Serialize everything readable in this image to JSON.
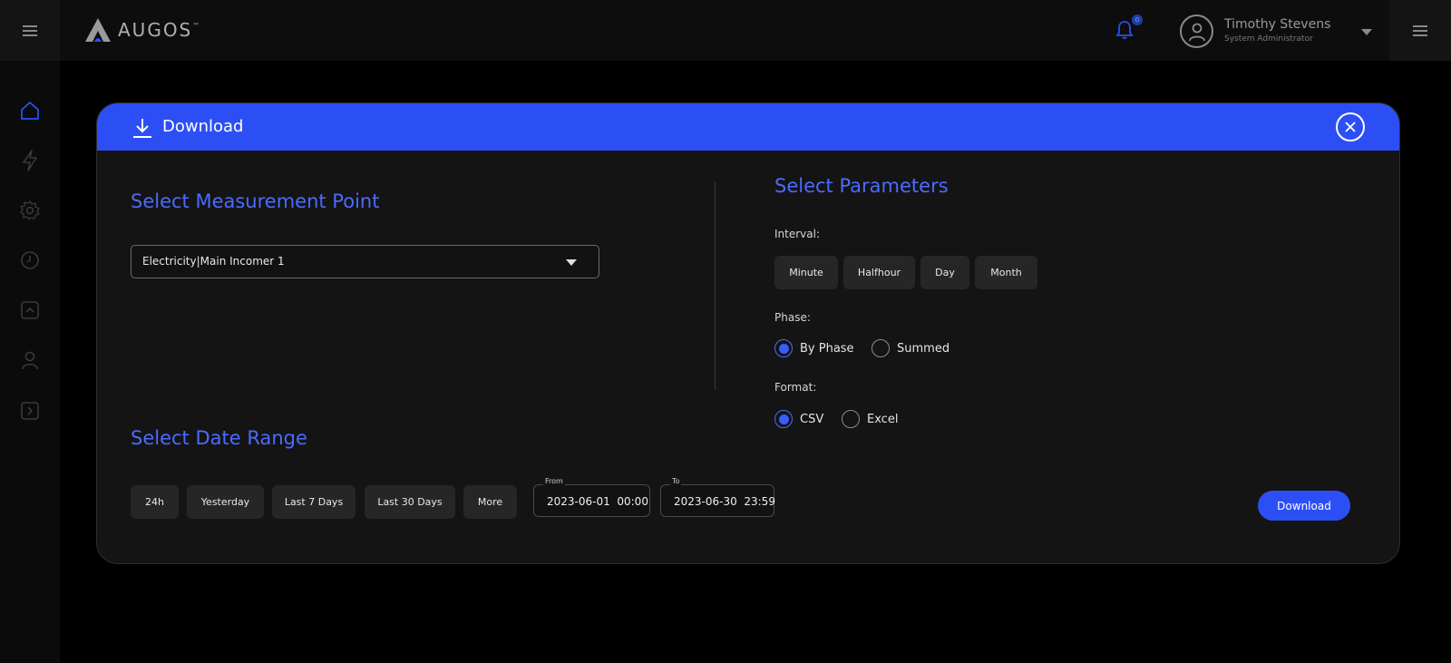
{
  "app": {
    "brand": "AUGOS",
    "brand_tm": "™",
    "notification_count": "0",
    "user": {
      "name": "Timothy Stevens",
      "role": "System Administrator"
    }
  },
  "sidebar": {
    "items": [
      {
        "icon": "home-icon"
      },
      {
        "icon": "lightning-icon"
      },
      {
        "icon": "gear-icon"
      },
      {
        "icon": "clock-icon"
      },
      {
        "icon": "chevron-up-box-icon"
      },
      {
        "icon": "user-icon"
      },
      {
        "icon": "chevron-right-box-icon"
      }
    ]
  },
  "modal": {
    "title": "Download",
    "measurement": {
      "title": "Select Measurement Point",
      "selected": "Electricity|Main Incomer 1"
    },
    "parameters": {
      "title": "Select Parameters",
      "interval_label": "Interval:",
      "intervals": [
        "Minute",
        "Halfhour",
        "Day",
        "Month"
      ],
      "phase_label": "Phase:",
      "phase_options": [
        "By Phase",
        "Summed"
      ],
      "phase_selected": "By Phase",
      "format_label": "Format:",
      "format_options": [
        "CSV",
        "Excel"
      ],
      "format_selected": "CSV"
    },
    "date_range": {
      "title": "Select Date Range",
      "presets": [
        "24h",
        "Yesterday",
        "Last 7 Days",
        "Last 30 Days",
        "More"
      ],
      "from_label": "From",
      "from_value": "2023-06-01  00:00",
      "to_label": "To",
      "to_value": "2023-06-30  23:59"
    },
    "download_label": "Download"
  },
  "colors": {
    "accent": "#2c4ff5",
    "accent_text": "#4b6bff",
    "panel": "#141414"
  }
}
